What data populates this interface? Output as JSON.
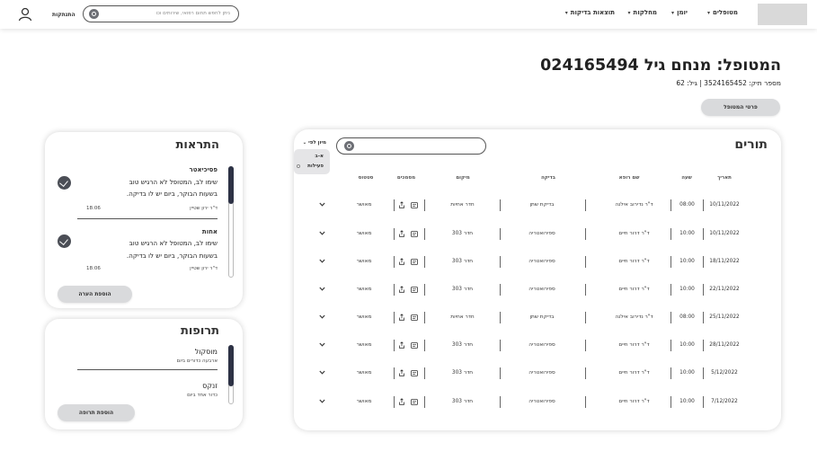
{
  "nav": {
    "items": [
      {
        "label": "מטופלים"
      },
      {
        "label": "יומן"
      },
      {
        "label": "מחלקות"
      },
      {
        "label": "תוצאות בדיקות"
      }
    ],
    "search_placeholder": "ניתן לחפש תחום רפואי, שירותים וכו",
    "logout_label": "התנתקות"
  },
  "patient": {
    "title": "המטופל: מנחם גיל 024165494",
    "subtitle": "מספר תיק: 3524165452  |  גיל: 62",
    "details_button": "פרטי המטופל"
  },
  "appointments": {
    "title": "תורים",
    "sort_label": "מיון לפי",
    "sort_options": [
      {
        "label": "א-ב"
      },
      {
        "label": "פעילות"
      }
    ],
    "columns": {
      "date": "תאריך",
      "time": "שעה",
      "doctor": "שם רופא",
      "test": "בדיקה",
      "location": "מיקום",
      "documents": "מסמכים",
      "status": "סטטוס"
    },
    "rows": [
      {
        "date": "10/11/2022",
        "time": "08:00",
        "doctor": "ד\"ר נדירוב אילנה",
        "test": "בדיקת שתן",
        "location": "חדר אחיות",
        "status": "מאושר"
      },
      {
        "date": "10/11/2022",
        "time": "10:00",
        "doctor": "ד\"ר דרור חיים",
        "test": "ספירואטריה",
        "location": "חדר 303",
        "status": "מאושר"
      },
      {
        "date": "18/11/2022",
        "time": "10:00",
        "doctor": "ד\"ר דרור חיים",
        "test": "ספירואטריה",
        "location": "חדר 303",
        "status": "מאושר"
      },
      {
        "date": "22/11/2022",
        "time": "10:00",
        "doctor": "ד\"ר דרור חיים",
        "test": "ספירואטריה",
        "location": "חדר 303",
        "status": "מאושר"
      },
      {
        "date": "25/11/2022",
        "time": "08:00",
        "doctor": "ד\"ר נדירוב אילנה",
        "test": "בדיקת שתן",
        "location": "חדר אחיות",
        "status": "מאושר"
      },
      {
        "date": "28/11/2022",
        "time": "10:00",
        "doctor": "ד\"ר דרור חיים",
        "test": "ספירואטריה",
        "location": "חדר 303",
        "status": "מאושר"
      },
      {
        "date": "5/12/2022",
        "time": "10:00",
        "doctor": "ד\"ר דרור חיים",
        "test": "ספירואטריה",
        "location": "חדר 303",
        "status": "מאושר"
      },
      {
        "date": "7/12/2022",
        "time": "10:00",
        "doctor": "ד\"ר דרור חיים",
        "test": "ספירואטריה",
        "location": "חדר 303",
        "status": "מאושר"
      }
    ]
  },
  "alerts": {
    "title": "התראות",
    "items": [
      {
        "category": "פסיכיאטר",
        "lines": [
          "שימו לב, המטופל לא הרגיש טוב",
          "בשעות הבוקר, ביום יש לו בדיקה."
        ],
        "author": "ד\"ר ירון שטיין",
        "time": "18:06"
      },
      {
        "category": "אחות",
        "lines": [
          "שימו לב, המטופל לא הרגיש טוב",
          "בשעות הבוקר, ביום יש לו בדיקה."
        ],
        "author": "ד\"ר ירון שטיין",
        "time": "18:06"
      }
    ],
    "add_button": "הוספת הערה"
  },
  "medications": {
    "title": "תרופות",
    "items": [
      {
        "name": "מוסקול",
        "dosage": "ארבעה כדורים ביום"
      },
      {
        "name": "זנקס",
        "dosage": "כדור אחד ביום"
      }
    ],
    "add_button": "הוספת תרופה"
  },
  "colors": {
    "accent": "#2d3245",
    "check": "#4b4e56",
    "button": "#d9dadc"
  }
}
